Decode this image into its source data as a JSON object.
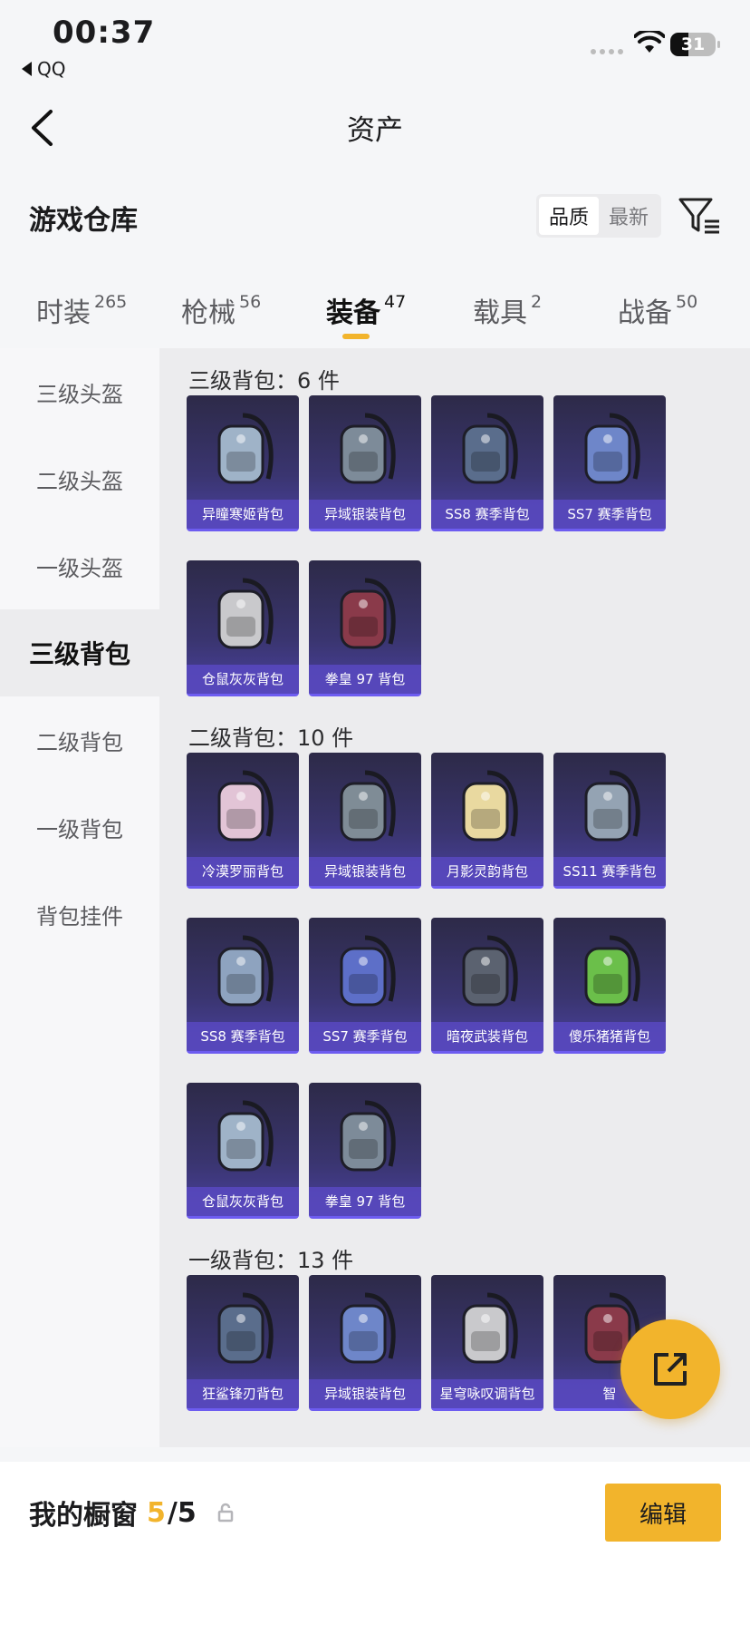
{
  "status_bar": {
    "time": "00:37",
    "back_app": "QQ",
    "battery": "31"
  },
  "nav": {
    "title": "资产"
  },
  "section": {
    "title": "游戏仓库",
    "sort_options": [
      "品质",
      "最新"
    ]
  },
  "tabs": [
    {
      "label": "时装",
      "count": "265"
    },
    {
      "label": "枪械",
      "count": "56"
    },
    {
      "label": "装备",
      "count": "47"
    },
    {
      "label": "载具",
      "count": "2"
    },
    {
      "label": "战备",
      "count": "50"
    }
  ],
  "sidebar": [
    "三级头盔",
    "二级头盔",
    "一级头盔",
    "三级背包",
    "二级背包",
    "一级背包",
    "背包挂件"
  ],
  "groups": [
    {
      "title": "三级背包：6 件",
      "items": [
        "异瞳寒姬背包",
        "异域银装背包",
        "SS8 赛季背包",
        "SS7 赛季背包",
        "仓鼠灰灰背包",
        "拳皇 97 背包"
      ]
    },
    {
      "title": "二级背包：10 件",
      "items": [
        "冷漠罗丽背包",
        "异域银装背包",
        "月影灵韵背包",
        "SS11 赛季背包",
        "SS8 赛季背包",
        "SS7 赛季背包",
        "暗夜武装背包",
        "傻乐猪猪背包",
        "仓鼠灰灰背包",
        "拳皇 97 背包"
      ]
    },
    {
      "title": "一级背包：13 件",
      "items": [
        "狂鲨锋刃背包",
        "异域银装背包",
        "星穹咏叹调背包",
        "智"
      ]
    }
  ],
  "bottom": {
    "label": "我的橱窗",
    "current": "5",
    "total": "/5",
    "edit": "编辑"
  },
  "colors": {
    "accent": "#f2b42c",
    "card_label_bg": "#5848be"
  }
}
